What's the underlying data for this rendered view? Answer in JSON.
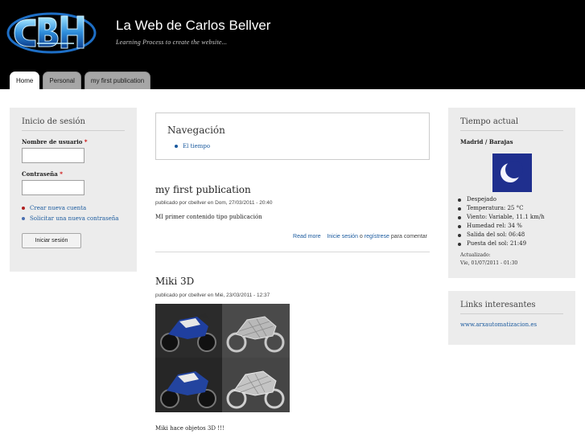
{
  "header": {
    "site_name": "La Web de Carlos Bellver",
    "site_slogan": "Learning  Process  to  create  the website...",
    "logo_icon": "cbh-logo"
  },
  "tabs": [
    {
      "label": "Home",
      "active": true
    },
    {
      "label": "Personal",
      "active": false
    },
    {
      "label": "my first publication",
      "active": false
    }
  ],
  "login": {
    "title": "Inicio de sesión",
    "username_label": "Nombre de usuario",
    "password_label": "Contraseña",
    "required_mark": "*",
    "links": [
      "Crear nueva cuenta",
      "Solicitar una nueva contraseña"
    ],
    "button_label": "Iniciar sesión"
  },
  "navigation": {
    "title": "Navegación",
    "items": [
      "El tiempo"
    ]
  },
  "nodes": [
    {
      "title": "my first publication",
      "meta": "publicado por cbellver en Dom, 27/03/2011 - 20:40",
      "body": "MI primer contenido tipo publicación",
      "links": {
        "read_more": "Read more",
        "login": "Inicie sesión",
        "connector": "o",
        "register": "regístrese",
        "suffix": "para comentar"
      }
    },
    {
      "title": "Miki 3D",
      "meta": "publicado por cbellver en Mié, 23/03/2011 - 12:37",
      "body": "Miki hace objetos 3D !!!"
    }
  ],
  "weather": {
    "title": "Tiempo actual",
    "location": "Madrid / Barajas",
    "icon": "moon-clear-night-icon",
    "items": [
      "Despejado",
      "Temperatura: 25 °C",
      "Viento: Variable, 11.1 km/h",
      "Humedad rel: 34 %",
      "Salida del sol: 06:48",
      "Puesta del sol: 21:49"
    ],
    "updated_label": "Actualizado:",
    "updated_value": "Vie, 01/07/2011 - 01:30"
  },
  "links_block": {
    "title": "Links interesantes",
    "items": [
      "www.arxautomatizacion.es"
    ]
  },
  "colors": {
    "header_bg": "#000000",
    "link": "#1a5a9e",
    "sidebar_bg": "#ececec",
    "weather_icon_bg": "#1f2f8e"
  }
}
